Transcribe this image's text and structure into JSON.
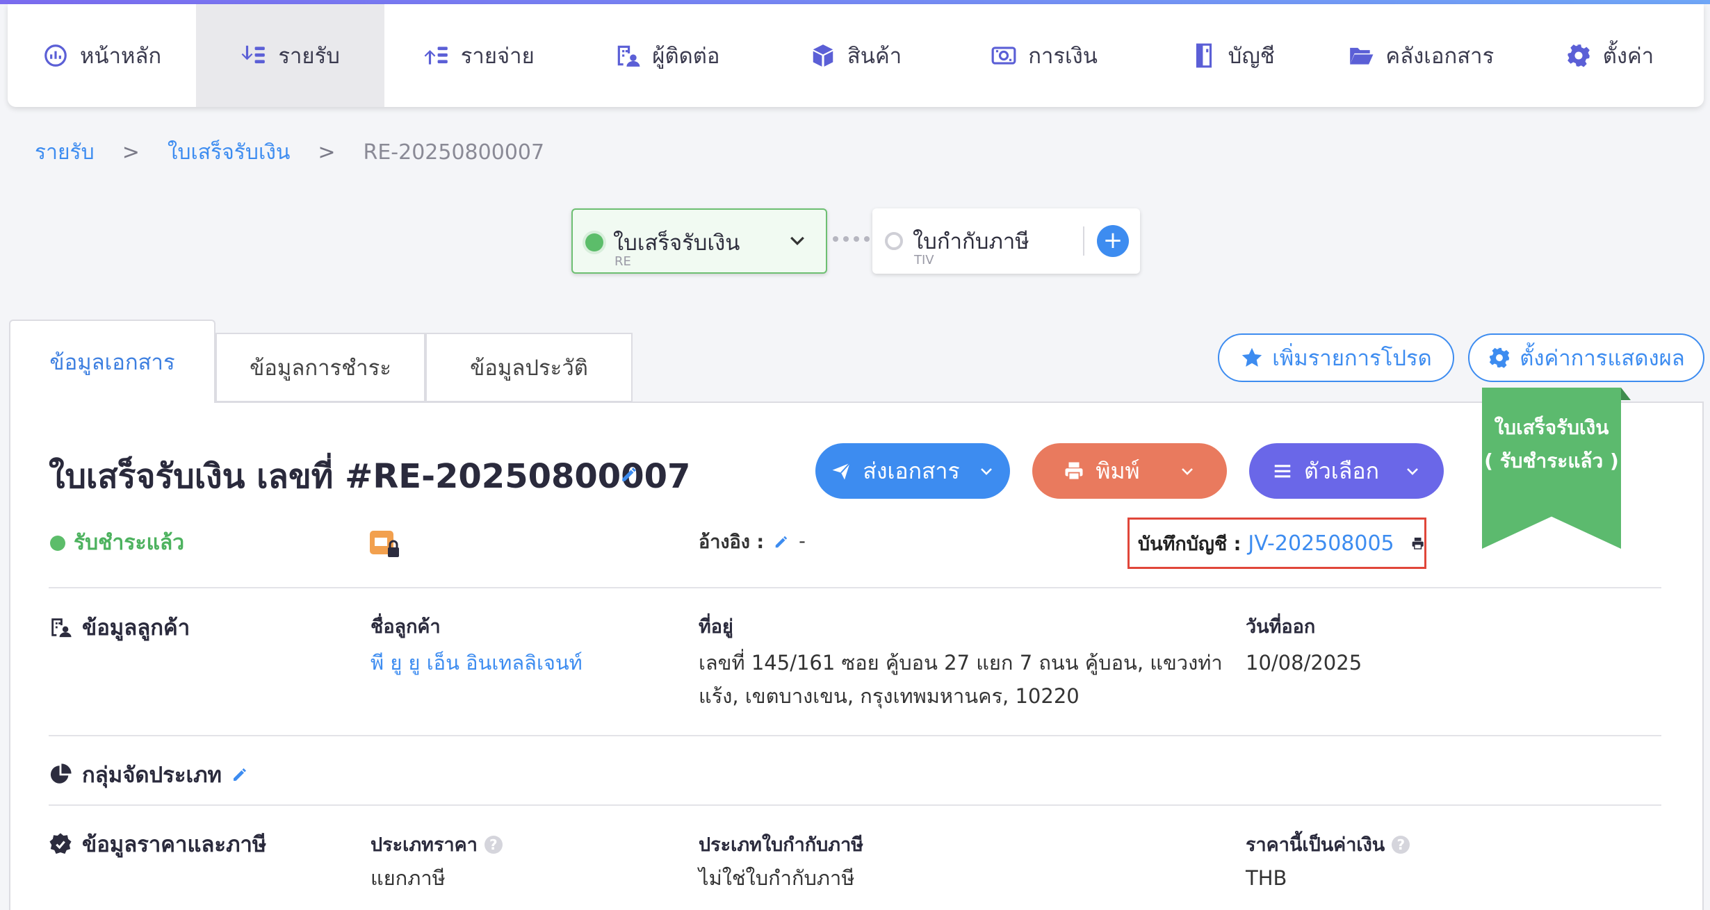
{
  "nav": {
    "items": [
      {
        "label": "หน้าหลัก",
        "icon": "dashboard-icon"
      },
      {
        "label": "รายรับ",
        "icon": "income-icon"
      },
      {
        "label": "รายจ่าย",
        "icon": "expense-icon"
      },
      {
        "label": "ผู้ติดต่อ",
        "icon": "contacts-icon"
      },
      {
        "label": "สินค้า",
        "icon": "product-box-icon"
      },
      {
        "label": "การเงิน",
        "icon": "money-icon"
      },
      {
        "label": "บัญชี",
        "icon": "ledger-book-icon"
      },
      {
        "label": "คลังเอกสาร",
        "icon": "folder-icon"
      },
      {
        "label": "ตั้งค่า",
        "icon": "gear-icon"
      }
    ],
    "active_index": 1
  },
  "breadcrumb": {
    "items": [
      "รายรับ",
      "ใบเสร็จรับเงิน",
      "RE-20250800007"
    ],
    "separator": ">"
  },
  "flow": {
    "receipt": {
      "title": "ใบเสร็จรับเงิน",
      "code": "RE"
    },
    "tax_invoice": {
      "title": "ใบกำกับภาษี",
      "code": "TIV",
      "add": "+"
    }
  },
  "tabs": [
    "ข้อมูลเอกสาร",
    "ข้อมูลการชำระ",
    "ข้อมูลประวัติ"
  ],
  "actions": {
    "favorite_label": "เพิ่มรายการโปรด",
    "display_settings_label": "ตั้งค่าการแสดงผล",
    "send_label": "ส่งเอกสาร",
    "print_label": "พิมพ์",
    "options_label": "ตัวเลือก"
  },
  "document": {
    "title": "ใบเสร็จรับเงิน เลขที่ #RE-20250800007",
    "status": "รับชำระแล้ว",
    "reference_label": "อ้างอิง :",
    "reference_value": "-",
    "journal_label": "บันทึกบัญชี :",
    "journal_value": "JV-202508005"
  },
  "ribbon": {
    "line1": "ใบเสร็จรับเงิน",
    "line2": "( รับชำระแล้ว )"
  },
  "customer": {
    "section_title": "ข้อมูลลูกค้า",
    "name_label": "ชื่อลูกค้า",
    "name_value": "พี ยู ยู เอ็น อินเทลลิเจนท์",
    "address_label": "ที่อยู่",
    "address_line1": "เลขที่ 145/161 ซอย คู้บอน 27 แยก 7 ถนน คู้บอน, แขวงท่า",
    "address_line2": "แร้ง, เขตบางเขน, กรุงเทพมหานคร, 10220",
    "issue_date_label": "วันที่ออก",
    "issue_date_value": "10/08/2025"
  },
  "classification": {
    "section_title": "กลุ่มจัดประเภท"
  },
  "pricing": {
    "section_title": "ข้อมูลราคาและภาษี",
    "price_type_label": "ประเภทราคา",
    "price_type_value": "แยกภาษี",
    "tax_invoice_type_label": "ประเภทใบกำกับภาษี",
    "tax_invoice_type_value": "ไม่ใช่ใบกำกับภาษี",
    "currency_label": "ราคานี้เป็นค่าเงิน",
    "currency_value": "THB",
    "help": "?"
  },
  "colors": {
    "accent": "#3d8cf0",
    "nav_icon": "#5b5fd6",
    "success": "#5cbd6a",
    "print_button": "#e97a5e",
    "options_button": "#6a67e8",
    "highlight_border": "#e0463a"
  }
}
